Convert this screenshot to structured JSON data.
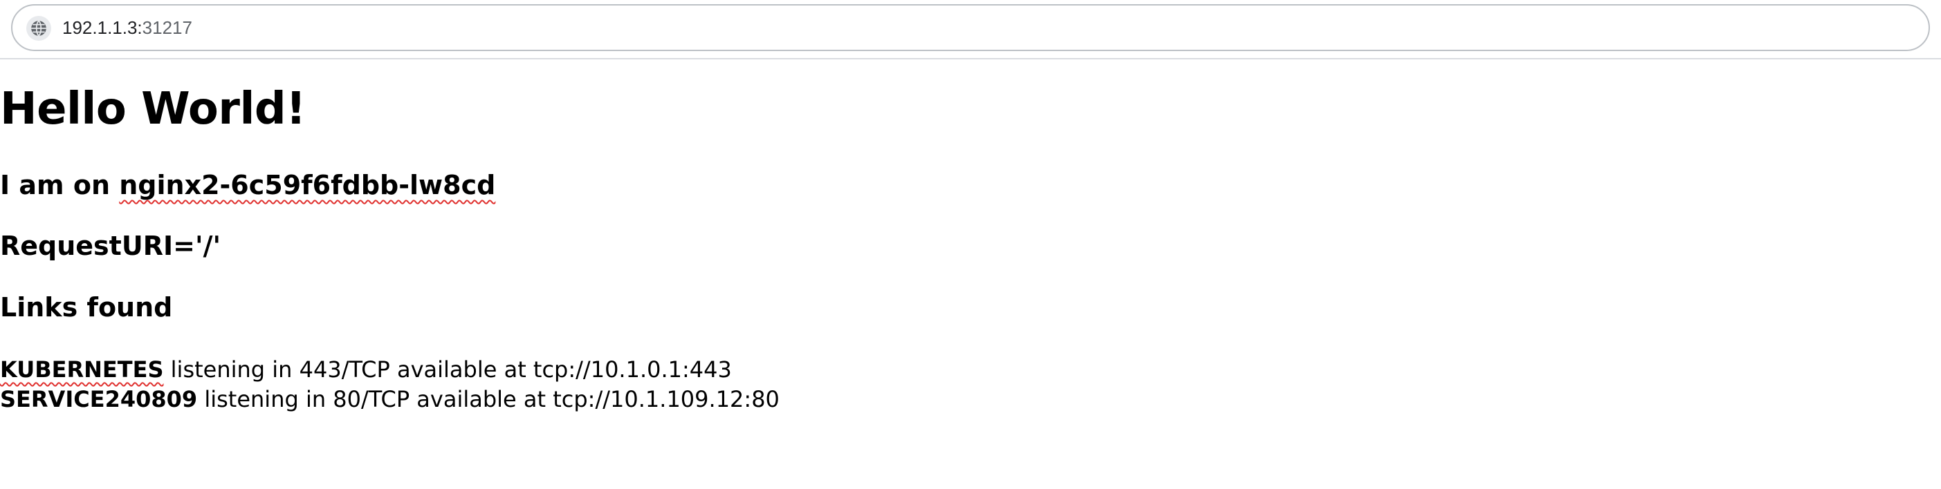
{
  "address_bar": {
    "host": "192.1.1.3:",
    "port": "31217",
    "icon": "globe-icon"
  },
  "page": {
    "title": "Hello World!",
    "host_prefix": "I am on ",
    "pod_name": "nginx2-6c59f6fdbb-lw8cd",
    "request_uri": "RequestURI='/'",
    "links_heading": "Links found",
    "links": [
      {
        "name": "KUBERNETES",
        "detail": " listening in 443/TCP available at tcp://10.1.0.1:443"
      },
      {
        "name": "SERVICE240809",
        "detail": " listening in 80/TCP available at tcp://10.1.109.12:80"
      }
    ]
  },
  "colors": {
    "spellcheck_underline": "#e0302e",
    "toolbar_border": "#dadce0"
  }
}
